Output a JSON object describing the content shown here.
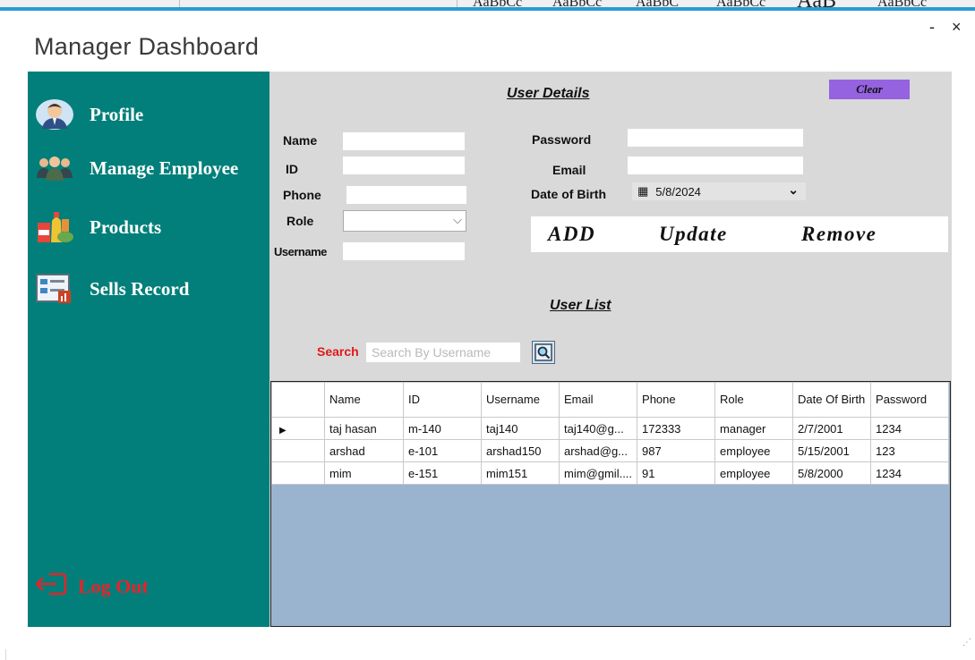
{
  "window": {
    "title": "Manager Dashboard",
    "minimize_label": "-",
    "close_label": "×"
  },
  "background_app": {
    "texts": [
      "AaBbCc",
      "AaBbCc",
      "AaBbC",
      "AaBbCc",
      "AaB",
      "AaBbCc"
    ]
  },
  "sidebar": {
    "items": [
      {
        "label": "Profile",
        "icon": "user-profile-icon"
      },
      {
        "label": "Manage Employee",
        "icon": "group-icon"
      },
      {
        "label": "Products",
        "icon": "products-icon"
      },
      {
        "label": "Sells Record",
        "icon": "sales-record-icon"
      }
    ],
    "logout_label": "Log Out"
  },
  "user_details": {
    "title": "User Details",
    "clear_label": "Clear",
    "labels": {
      "name": "Name",
      "id": "ID",
      "phone": "Phone",
      "role": "Role",
      "username": "Username",
      "password": "Password",
      "email": "Email",
      "dob": "Date of Birth"
    },
    "values": {
      "name": "",
      "id": "",
      "phone": "",
      "role": "",
      "username": "",
      "password": "",
      "email": "",
      "dob": "5/8/2024"
    },
    "buttons": {
      "add": "ADD",
      "update": "Update",
      "remove": "Remove"
    }
  },
  "user_list": {
    "title": "User List",
    "search_label": "Search",
    "search_placeholder": "Search By Username",
    "columns": [
      "Name",
      "ID",
      "Username",
      "Email",
      "Phone",
      "Role",
      "Date Of Birth",
      "Password"
    ],
    "rows": [
      [
        "taj hasan",
        "m-140",
        "taj140",
        "taj140@g...",
        "172333",
        "manager",
        "2/7/2001",
        "1234"
      ],
      [
        "arshad",
        "e-101",
        "arshad150",
        "arshad@g...",
        "987",
        "employee",
        "5/15/2001",
        "123"
      ],
      [
        "mim",
        "e-151",
        "mim151",
        "mim@gmil....",
        "91",
        "employee",
        "5/8/2000",
        "1234"
      ]
    ],
    "selected_row": 0
  },
  "colors": {
    "sidebar": "#027f7a",
    "content": "#d9d9d9",
    "clear_button": "#9562e0",
    "grid_background": "#9ab3cf",
    "search_label": "#e01818",
    "logout": "#e4242a"
  }
}
